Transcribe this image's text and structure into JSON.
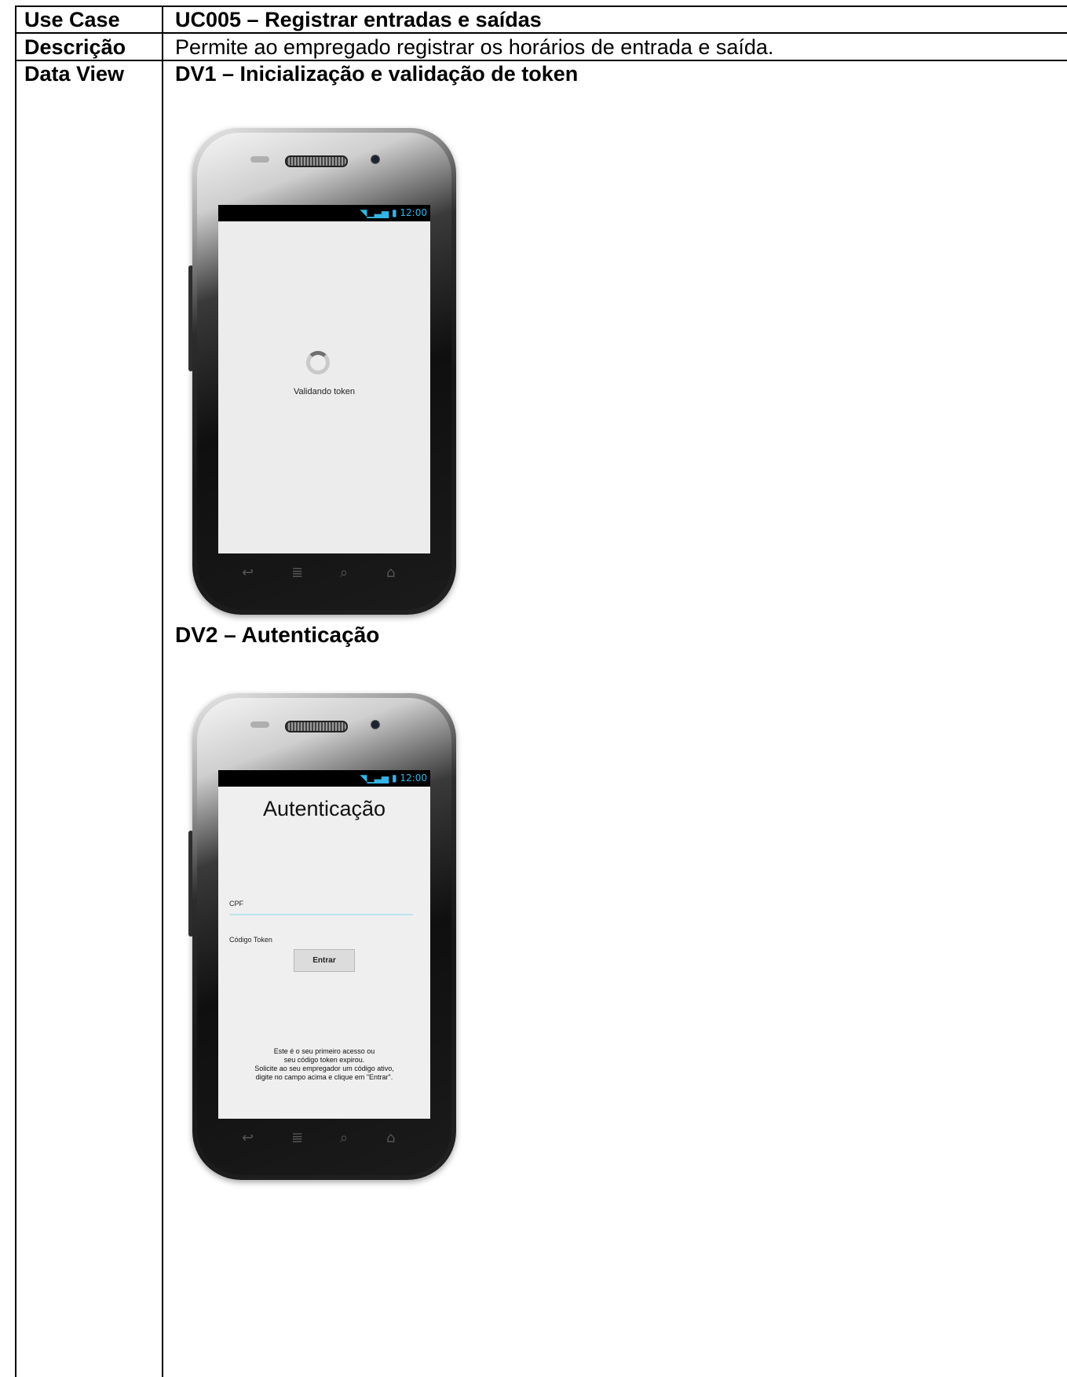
{
  "table": {
    "rows": [
      {
        "label": "Use Case",
        "value": "UC005 – Registrar entradas e saídas"
      },
      {
        "label": "Descrição",
        "value": "Permite ao empregado registrar os horários de entrada e saída."
      },
      {
        "label": "Data View",
        "value": "DV1 – Inicialização e validação de token"
      }
    ],
    "dv2_heading": "DV2 – Autenticação"
  },
  "phone_status": {
    "time": "12:00",
    "signal_icons": "wifi-signal-battery"
  },
  "dv1": {
    "loading_text": "Validando token"
  },
  "dv2": {
    "title": "Autenticação",
    "cpf_label": "CPF",
    "token_label": "Código Token",
    "button": "Entrar",
    "message_lines": [
      "Este é o seu primeiro acesso ou",
      "seu código token expirou.",
      "Solicite ao seu empregador um código ativo,",
      "digite no campo acima e clique em \"Entrar\"."
    ]
  }
}
